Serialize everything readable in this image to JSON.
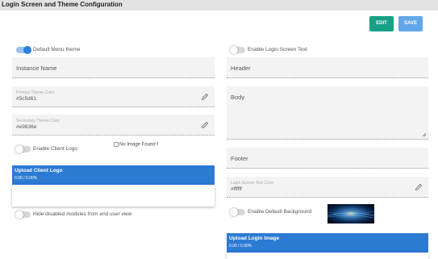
{
  "header": {
    "title": "Login Screen and Theme Configuration"
  },
  "toolbar": {
    "edit_label": "EDIT",
    "save_label": "SAVE"
  },
  "left": {
    "default_menu_theme": {
      "label": "Default Menu theme",
      "on": true
    },
    "instance_name": {
      "placeholder": "Instance Name"
    },
    "primary_color": {
      "label": "Primary Theme Color",
      "value": "#5c5d61"
    },
    "secondary_color": {
      "label": "Secondary Theme Color",
      "value": "#e9836e"
    },
    "client_logo": {
      "label": "Enable Client Logo",
      "on": false,
      "image_alt": "No Image Found f"
    },
    "upload_client_logo": {
      "title": "Upload Client Logo",
      "progress": "0.00 / 0.00%"
    },
    "hide_disabled": {
      "label": "Hide disabled modules from end user view",
      "on": false
    }
  },
  "right": {
    "login_screen_text": {
      "label": "Enable Login Screen Text",
      "on": false
    },
    "header_field": {
      "placeholder": "Header"
    },
    "body_field": {
      "placeholder": "Body"
    },
    "footer_field": {
      "placeholder": "Footer"
    },
    "text_color": {
      "label": "Login Screen Text Color",
      "value": "#ffffff"
    },
    "default_background": {
      "label": "Enable Default Background",
      "on": false
    },
    "upload_login_image": {
      "title": "Upload Login Image",
      "progress": "0.00 / 0.00%"
    }
  },
  "icons": {
    "color_picker": "pencil-icon"
  },
  "colors": {
    "edit_button": "#17a086",
    "save_button": "#62a7ea",
    "upload_bar": "#2b7bd3",
    "toggle_on": "#2c7fe0"
  }
}
